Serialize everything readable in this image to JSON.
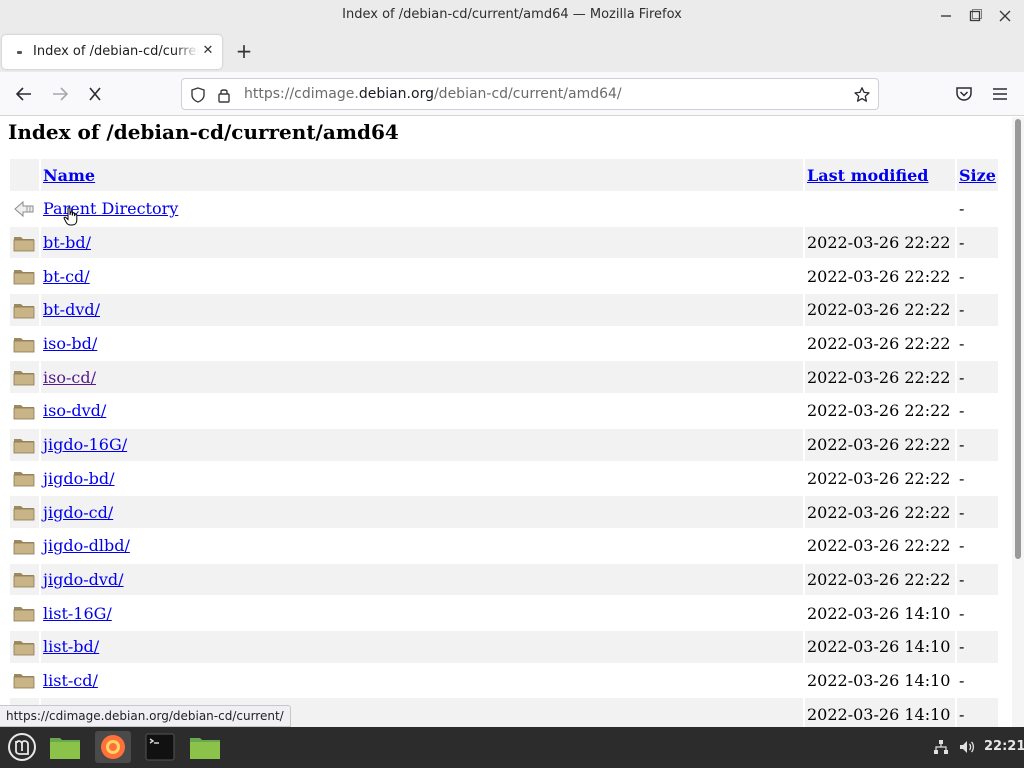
{
  "window": {
    "title": "Index of /debian-cd/current/amd64 — Mozilla Firefox"
  },
  "tab": {
    "title": "Index of /debian-cd/current/amd64",
    "close_label": "✕",
    "new_tab_label": "+"
  },
  "urlbar": {
    "prefix": "https://cdimage.",
    "domain": "debian.org",
    "path": "/debian-cd/current/amd64/"
  },
  "page": {
    "heading": "Index of /debian-cd/current/amd64",
    "columns": {
      "name": "Name",
      "modified": "Last modified",
      "size": "Size"
    },
    "parent": {
      "name": "Parent Directory",
      "size": "-"
    },
    "rows": [
      {
        "name": "bt-bd/",
        "modified": "2022-03-26 22:22",
        "size": "-"
      },
      {
        "name": "bt-cd/",
        "modified": "2022-03-26 22:22",
        "size": "-"
      },
      {
        "name": "bt-dvd/",
        "modified": "2022-03-26 22:22",
        "size": "-"
      },
      {
        "name": "iso-bd/",
        "modified": "2022-03-26 22:22",
        "size": "-"
      },
      {
        "name": "iso-cd/",
        "modified": "2022-03-26 22:22",
        "size": "-"
      },
      {
        "name": "iso-dvd/",
        "modified": "2022-03-26 22:22",
        "size": "-"
      },
      {
        "name": "jigdo-16G/",
        "modified": "2022-03-26 22:22",
        "size": "-"
      },
      {
        "name": "jigdo-bd/",
        "modified": "2022-03-26 22:22",
        "size": "-"
      },
      {
        "name": "jigdo-cd/",
        "modified": "2022-03-26 22:22",
        "size": "-"
      },
      {
        "name": "jigdo-dlbd/",
        "modified": "2022-03-26 22:22",
        "size": "-"
      },
      {
        "name": "jigdo-dvd/",
        "modified": "2022-03-26 22:22",
        "size": "-"
      },
      {
        "name": "list-16G/",
        "modified": "2022-03-26 14:10",
        "size": "-"
      },
      {
        "name": "list-bd/",
        "modified": "2022-03-26 14:10",
        "size": "-"
      },
      {
        "name": "list-cd/",
        "modified": "2022-03-26 14:10",
        "size": "-"
      },
      {
        "name": "",
        "modified": "2022-03-26 14:10",
        "size": "-"
      }
    ]
  },
  "statusbar": {
    "text": "https://cdimage.debian.org/debian-cd/current/"
  },
  "taskbar": {
    "clock": "22:21"
  },
  "colors": {
    "link": "#0000ee",
    "visited_link": "#551a8b",
    "folder": "#b5a27a",
    "taskbar_bg": "#2c2c2c",
    "firefox_orange": "#ff7139"
  },
  "icons": {
    "back": "arrow-left-icon",
    "forward": "arrow-right-icon",
    "stop": "close-icon",
    "tracking": "shield-icon",
    "site_info": "lock-icon",
    "bookmark": "star-icon",
    "pocket": "pocket-icon",
    "menu": "hamburger-menu-icon",
    "parent_directory": "back-arrow-icon",
    "folder": "folder-icon"
  }
}
